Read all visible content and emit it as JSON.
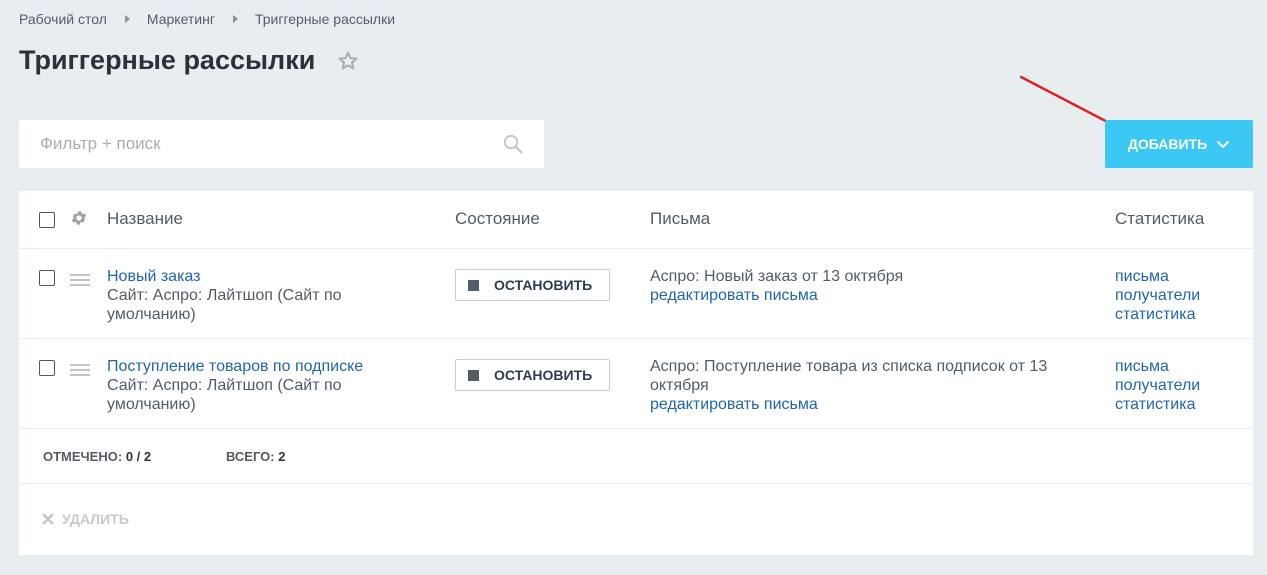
{
  "breadcrumbs": [
    "Рабочий стол",
    "Маркетинг",
    "Триггерные рассылки"
  ],
  "page_title": "Триггерные рассылки",
  "filter": {
    "placeholder": "Фильтр + поиск"
  },
  "add_button": {
    "label": "ДОБАВИТЬ"
  },
  "columns": {
    "name": "Название",
    "state": "Состояние",
    "letters": "Письма",
    "stats": "Статистика"
  },
  "rows": [
    {
      "title": "Новый заказ",
      "site": "Сайт: Аспро: Лайтшоп (Сайт по умолчанию)",
      "stop_label": "ОСТАНОВИТЬ",
      "letter": "Аспро: Новый заказ от 13 октября",
      "edit_letters": "редактировать письма",
      "stats": [
        "письма",
        "получатели",
        "статистика"
      ]
    },
    {
      "title": "Поступление товаров по подписке",
      "site": "Сайт: Аспро: Лайтшоп (Сайт по умолчанию)",
      "stop_label": "ОСТАНОВИТЬ",
      "letter": "Аспро: Поступление товара из списка подписок от 13 октября",
      "edit_letters": "редактировать письма",
      "stats": [
        "письма",
        "получатели",
        "статистика"
      ]
    }
  ],
  "footer": {
    "selected_label": "ОТМЕЧЕНО:",
    "selected_value": "0 / 2",
    "total_label": "ВСЕГО:",
    "total_value": "2"
  },
  "delete_label": "УДАЛИТЬ",
  "colors": {
    "accent": "#3bc8f5",
    "link": "#2067b0",
    "arrow": "#e02020",
    "background": "#e8edf0"
  }
}
